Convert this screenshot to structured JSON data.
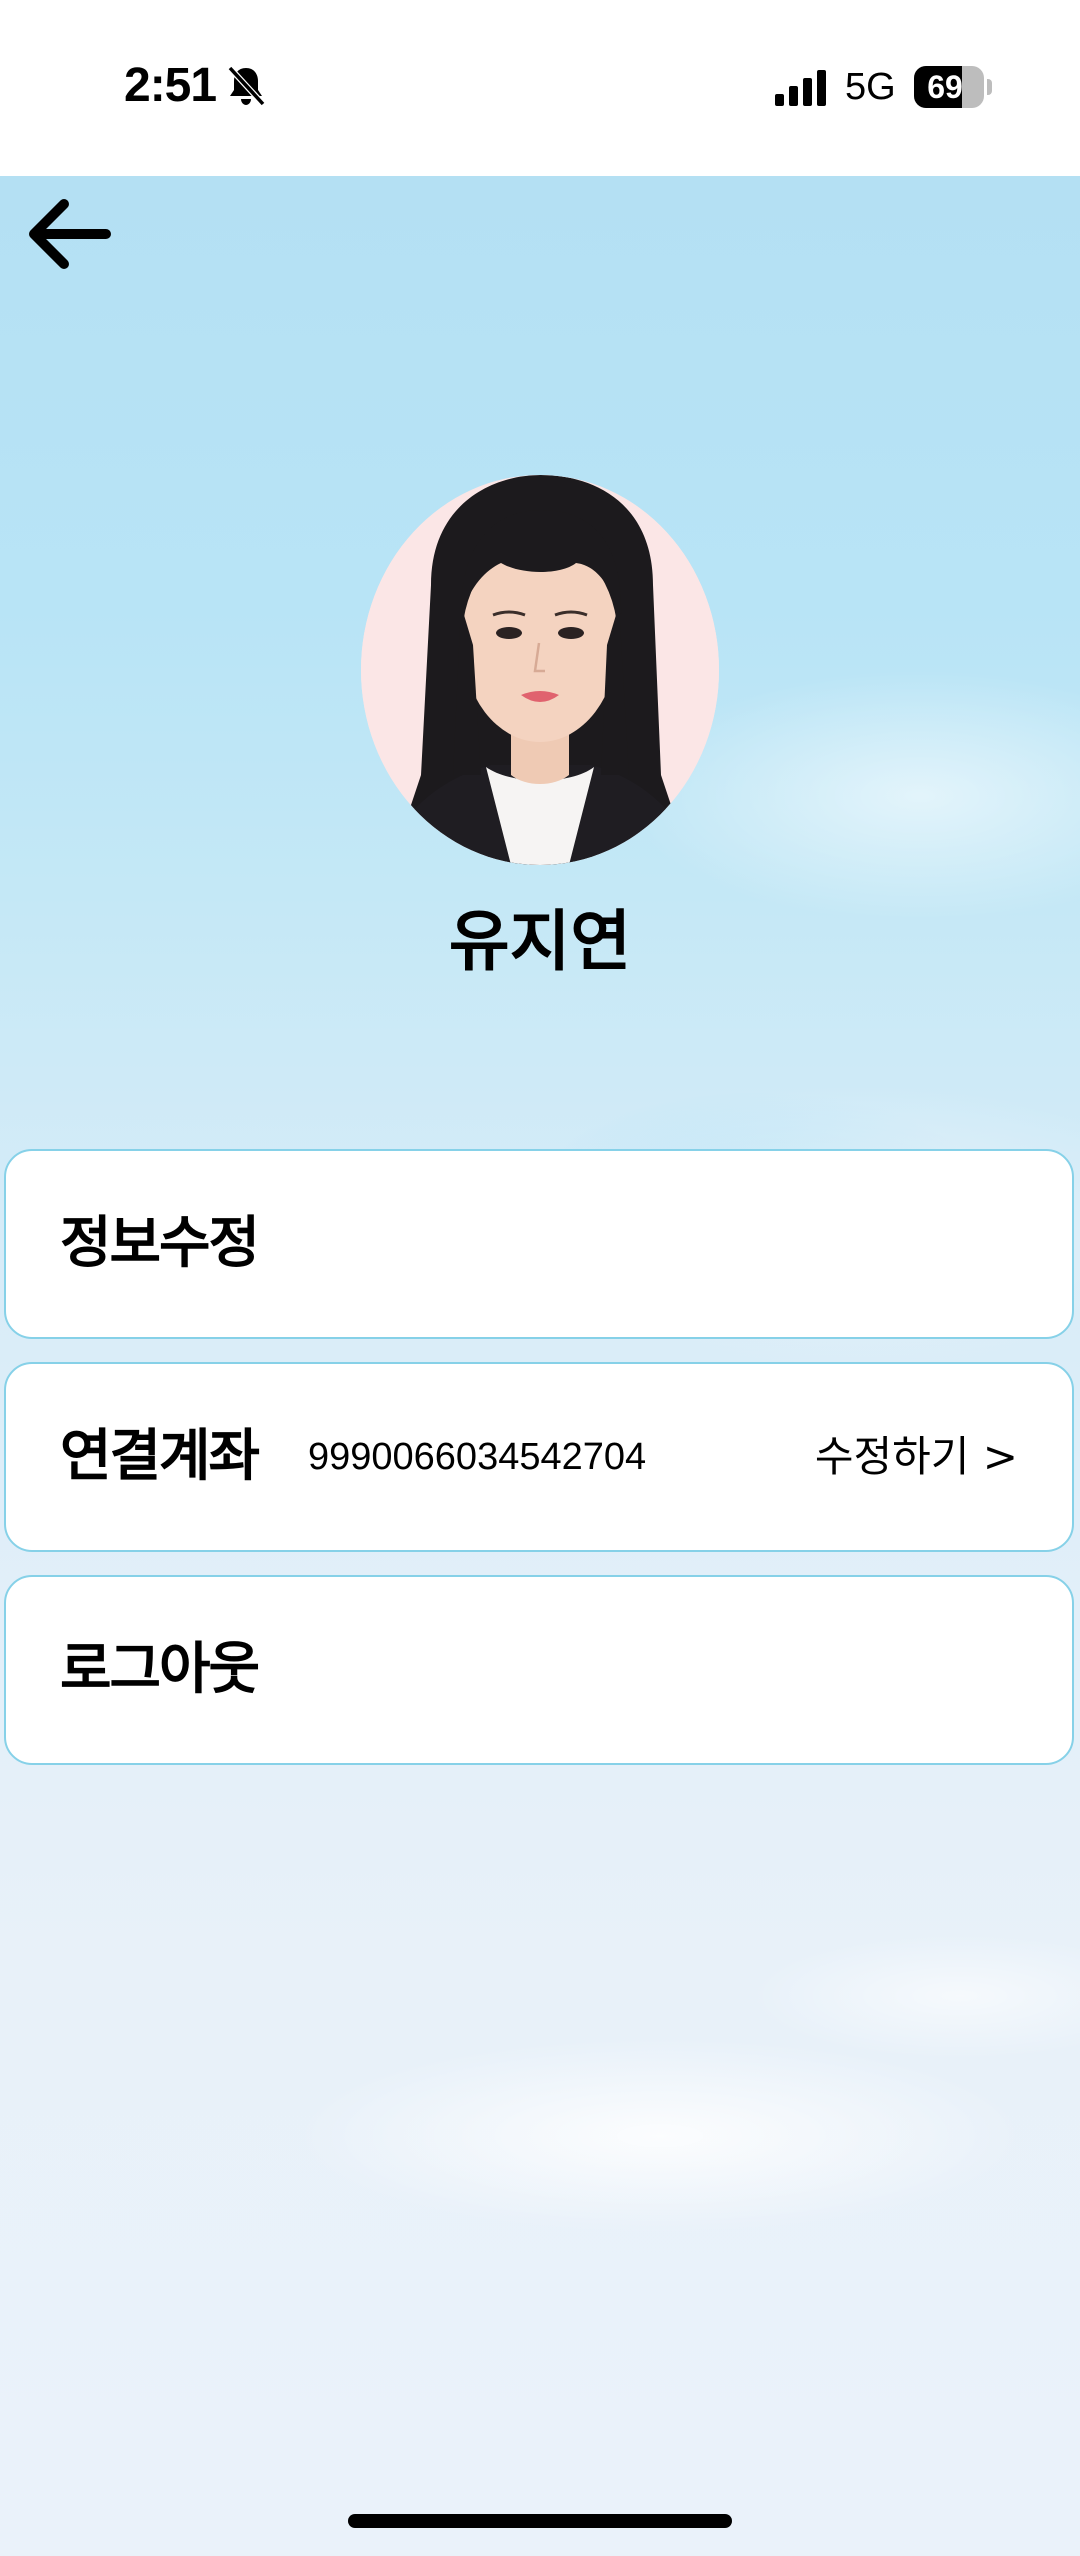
{
  "status_bar": {
    "time": "2:51",
    "network": "5G",
    "battery_level": "69",
    "battery_fraction": 0.69,
    "icons": [
      "bell-slash-icon",
      "signal-icon"
    ]
  },
  "nav": {
    "back_icon": "arrow-left-icon"
  },
  "profile": {
    "name": "유지연"
  },
  "menu": {
    "edit_info_label": "정보수정",
    "linked_account_label": "연결계좌",
    "account_number": "9990066034542704",
    "edit_account_label": "수정하기 >",
    "logout_label": "로그아웃"
  },
  "colors": {
    "card_border": "#86d1e8",
    "sky_top": "#b4e0f3",
    "sky_bottom": "#eaf2fa"
  }
}
